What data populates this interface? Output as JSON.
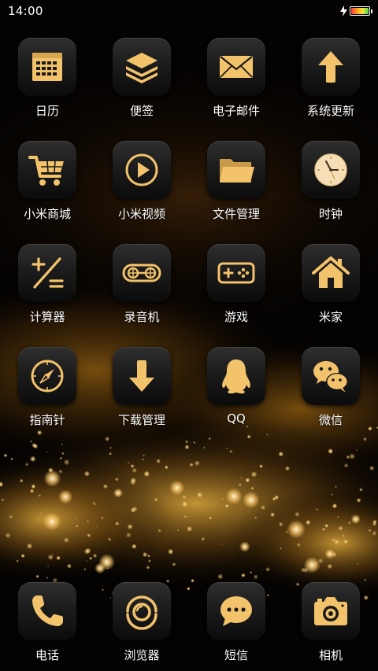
{
  "status_bar": {
    "time": "14:00",
    "battery_icon": "battery-icon",
    "charging_icon": "charging-bolt-icon"
  },
  "colors": {
    "icon_gold": "#F3C36B",
    "tile_dark": "#1A1A1A",
    "wallpaper_gold": "#C8922E"
  },
  "apps": [
    {
      "label": "日历",
      "icon": "calendar-icon"
    },
    {
      "label": "便签",
      "icon": "layers-icon"
    },
    {
      "label": "电子邮件",
      "icon": "envelope-icon"
    },
    {
      "label": "系统更新",
      "icon": "arrow-up-icon"
    },
    {
      "label": "小米商城",
      "icon": "shopping-cart-icon"
    },
    {
      "label": "小米视频",
      "icon": "play-icon"
    },
    {
      "label": "文件管理",
      "icon": "folder-icon"
    },
    {
      "label": "时钟",
      "icon": "clock-icon"
    },
    {
      "label": "计算器",
      "icon": "calculator-icon"
    },
    {
      "label": "录音机",
      "icon": "tape-recorder-icon"
    },
    {
      "label": "游戏",
      "icon": "gamepad-icon"
    },
    {
      "label": "米家",
      "icon": "home-icon"
    },
    {
      "label": "指南针",
      "icon": "compass-icon"
    },
    {
      "label": "下载管理",
      "icon": "download-arrow-icon"
    },
    {
      "label": "QQ",
      "icon": "penguin-icon"
    },
    {
      "label": "微信",
      "icon": "chat-bubbles-icon"
    }
  ],
  "dock": [
    {
      "label": "电话",
      "icon": "phone-icon"
    },
    {
      "label": "浏览器",
      "icon": "browser-icon"
    },
    {
      "label": "短信",
      "icon": "message-icon"
    },
    {
      "label": "相机",
      "icon": "camera-icon"
    }
  ]
}
